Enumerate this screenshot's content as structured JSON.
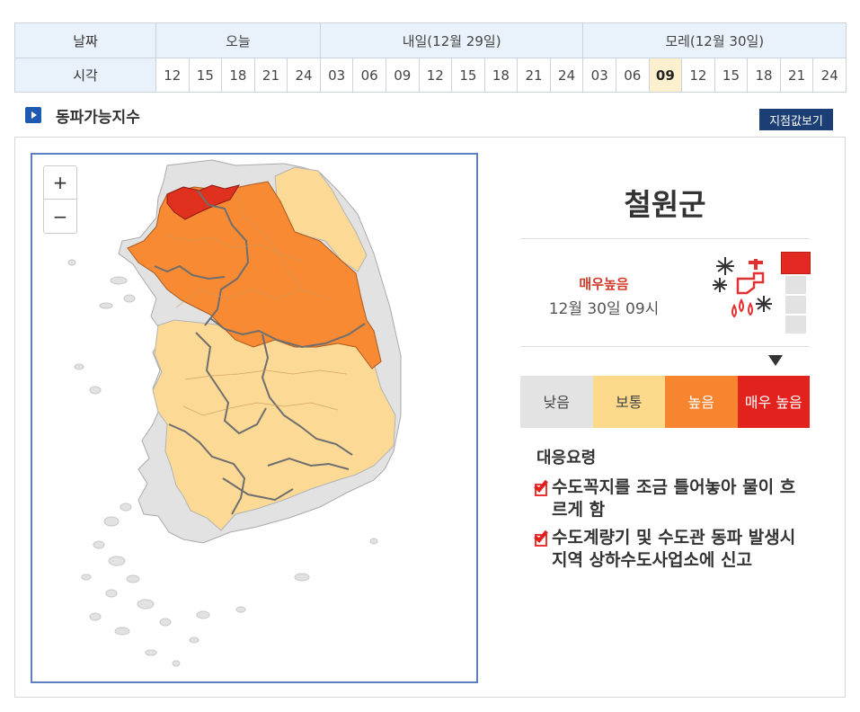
{
  "table": {
    "date_header": "날짜",
    "time_header": "시각",
    "days": [
      {
        "label": "오늘",
        "hours": [
          "12",
          "15",
          "18",
          "21",
          "24"
        ]
      },
      {
        "label": "내일(12월 29일)",
        "hours": [
          "03",
          "06",
          "09",
          "12",
          "15",
          "18",
          "21",
          "24"
        ]
      },
      {
        "label": "모레(12월 30일)",
        "hours": [
          "03",
          "06",
          "09",
          "12",
          "15",
          "18",
          "21",
          "24"
        ]
      }
    ],
    "selected": {
      "day": 2,
      "hour_index": 2
    }
  },
  "section": {
    "title": "동파가능지수",
    "point_button": "지점값보기"
  },
  "map": {
    "zoom_in": "+",
    "zoom_out": "−",
    "colors": {
      "very_high": "#e0301e",
      "high": "#f98a34",
      "normal": "#fdd996",
      "low": "#e2e2e2",
      "border": "#777777",
      "frame": "#5b7fbf"
    }
  },
  "info": {
    "region": "철원군",
    "level": "매우높음",
    "time": "12월 30일 09시",
    "icon": "frozen-pipe-icon",
    "active_level_index": 0
  },
  "legend": [
    {
      "label": "낮음",
      "color": "#e3e3e3"
    },
    {
      "label": "보통",
      "color": "#fcd98b"
    },
    {
      "label": "높음",
      "color": "#f7852f"
    },
    {
      "label": "매우 높음",
      "color": "#e2231d"
    }
  ],
  "response": {
    "title": "대응요령",
    "items": [
      "수도꼭지를 조금 틀어놓아 물이 흐르게 함",
      "수도계량기 및 수도관 동파 발생시 지역 상하수도사업소에 신고"
    ]
  }
}
